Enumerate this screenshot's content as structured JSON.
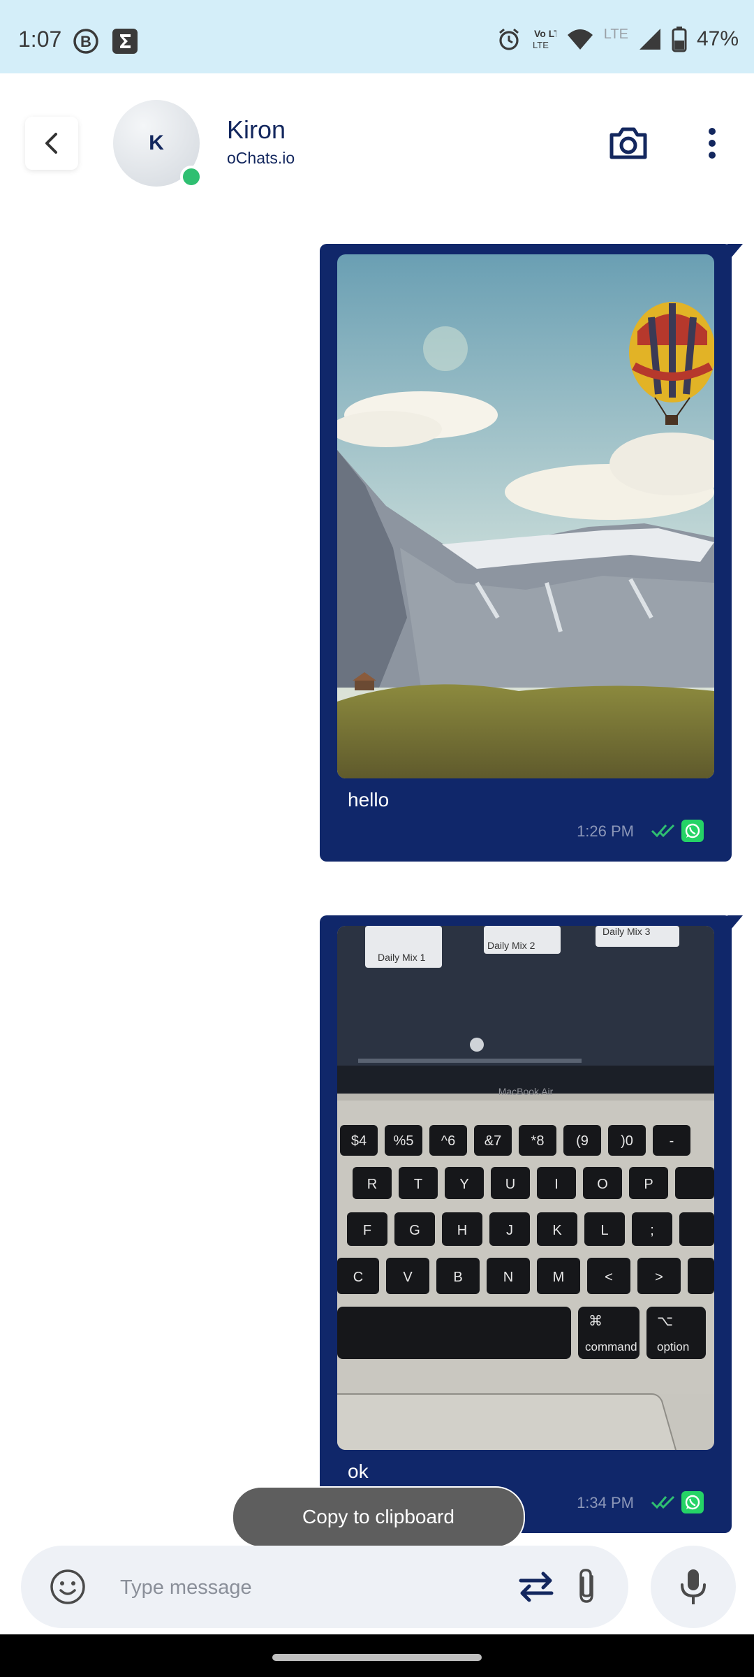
{
  "status_bar": {
    "time": "1:07",
    "battery": "47%",
    "lte_label": "LTE",
    "volte_label": "Vo LTE",
    "icons": [
      "b-circle-icon",
      "sigma-icon",
      "alarm-icon",
      "volte-icon",
      "wifi-icon",
      "signal-icon",
      "battery-icon"
    ]
  },
  "header": {
    "avatar_initial": "K",
    "contact_name": "Kiron",
    "contact_subtitle": "oChats.io",
    "online": true,
    "icons": [
      "back-arrow-icon",
      "camera-icon",
      "more-vertical-icon"
    ]
  },
  "messages": [
    {
      "text": "hello",
      "time": "1:26 PM",
      "status": "read",
      "channel": "whatsapp",
      "image": "mountain-balloon-photo"
    },
    {
      "text": "ok",
      "time": "1:34 PM",
      "status": "read",
      "channel": "whatsapp",
      "image": "laptop-keyboard-photo"
    }
  ],
  "keyboard_photo": {
    "screen_cards": [
      "Daily Mix 1",
      "Daily Mix 2",
      "Daily Mix 3"
    ],
    "brand": "MacBook Air",
    "rows": [
      [
        "$4",
        "%5",
        "^6",
        "&7",
        "*8",
        "(9",
        ")0",
        "-"
      ],
      [
        "R",
        "T",
        "Y",
        "U",
        "I",
        "O",
        "P"
      ],
      [
        "F",
        "G",
        "H",
        "J",
        "K",
        "L",
        ";"
      ],
      [
        "C",
        "V",
        "B",
        "N",
        "M",
        "<",
        ">"
      ]
    ],
    "command_label": "command",
    "option_label": "option",
    "command_symbol": "⌘",
    "option_symbol": "⌥"
  },
  "toast": {
    "text": "Copy to clipboard"
  },
  "composer": {
    "placeholder": "Type message",
    "icons": [
      "emoji-icon",
      "swap-arrows-icon",
      "paperclip-icon",
      "microphone-icon"
    ]
  },
  "colors": {
    "status_bar_bg": "#d4eef9",
    "brand_navy": "#10276a",
    "online_green": "#2fbf71",
    "whatsapp_green": "#25d366",
    "composer_bg": "#eef1f6"
  }
}
